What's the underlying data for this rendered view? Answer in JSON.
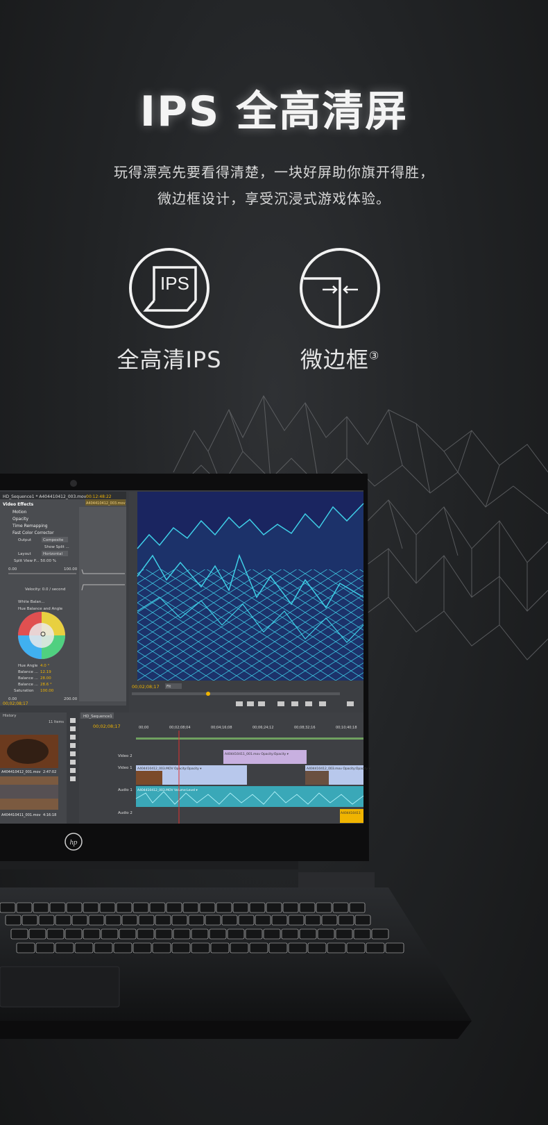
{
  "header": {
    "title": "IPS 全高清屏",
    "desc_line1": "玩得漂亮先要看得清楚，一块好屏助你旗开得胜，",
    "desc_line2": "微边框设计，享受沉浸式游戏体验。"
  },
  "features": [
    {
      "label": "全高清IPS",
      "icon_text": "IPS",
      "icon": "laptop-ips-icon"
    },
    {
      "label": "微边框",
      "sup": "③",
      "icon": "narrow-bezel-icon"
    }
  ],
  "screen": {
    "panel_title": "HD_Sequence1 * A404410412_003.mov",
    "panel_time": "00:12:48:22",
    "clip_label": "A404410412_003.mov",
    "effects": [
      "Video Effects",
      "Motion",
      "Opacity",
      "Time Remapping",
      "Fast Color Corrector"
    ],
    "output_label": "Output",
    "output_value": "Composite",
    "show_split": "Show Split ...",
    "layout_label": "Layout",
    "layout_value": "Horizontal",
    "split_view": "Split View P... 50.00 %",
    "range_min": "0.00",
    "range_max": "100.00",
    "velocity": "Velocity: 0.0 / second",
    "white_balance": "White Balan...",
    "hue_balance": "Hue Balance and Angle",
    "hue_angle": "Hue Angle",
    "hue_angle_val": "4.0 °",
    "balance1": "Balance ...",
    "balance1_val": "12.19",
    "balance2": "Balance ...",
    "balance2_val": "28.00",
    "balance3": "Balance ...",
    "balance3_val": "28.6 °",
    "saturation": "Saturation",
    "saturation_val": "100.00",
    "sat_min": "0.00",
    "sat_max": "200.00",
    "left_time": "00;02;08;17",
    "monitor_time": "00;02;08;17",
    "monitor_fit": "Fit",
    "history": "History",
    "items": "11 Items",
    "thumb1": "A404410412_001.mov",
    "thumb1_dur": "2:47:02",
    "thumb2": "A404410411_001.mov",
    "thumb2_dur": "4:16:18",
    "seq_tab": "HD_Sequence1",
    "seq_time": "00;02;08;17",
    "ruler": [
      "00;00",
      "00;02;08;04",
      "00;04;16;08",
      "00;06;24;12",
      "00;08;32;16",
      "00;10;40;18"
    ],
    "tracks": [
      "Video 2",
      "Video 1",
      "Audio 1",
      "Audio 2"
    ],
    "clip_v2": "A404410411_001.mov Opacity:Opacity ▾",
    "clip_v1a": "A404410412_003.MOV  Opacity:Opacity ▾",
    "clip_v1b": "A404410412_003.mov Opacity:Opacity ▾",
    "clip_a1": "A404410412_003.MOV  Volume:Level ▾",
    "clip_a2": "A404410411"
  },
  "brand": {
    "logo": "hp"
  },
  "colors": {
    "accent": "#f0b400",
    "terrain": "#3fd0e8",
    "screen_bg": "#1a2560"
  }
}
